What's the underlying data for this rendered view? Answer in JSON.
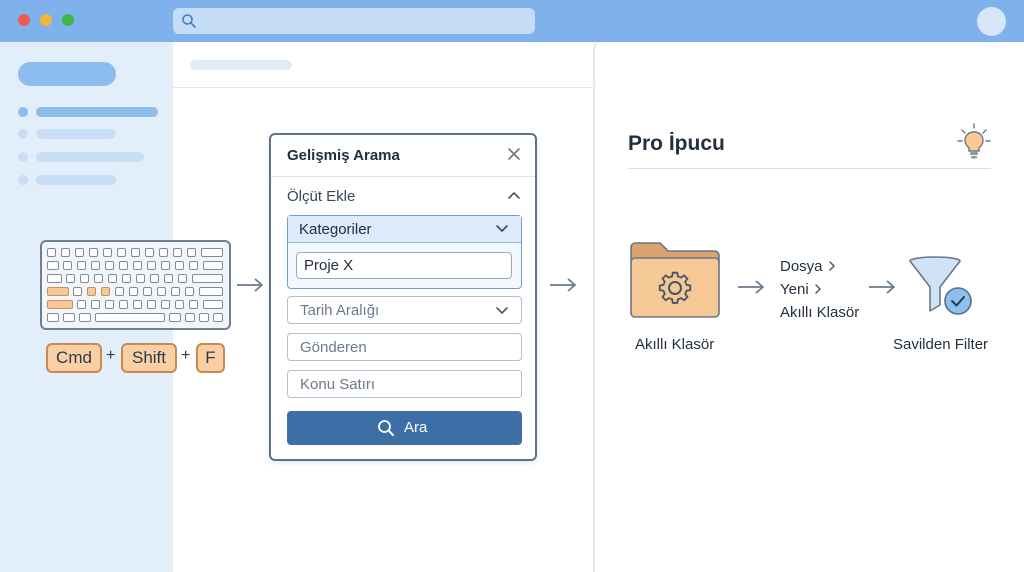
{
  "dialog": {
    "title": "Gelişmiş Arama",
    "criteria_label": "Ölçüt Ekle",
    "category_label": "Kategoriler",
    "category_value": "Proje X",
    "date_range_placeholder": "Tarih Aralığı",
    "sender_placeholder": "Gönderen",
    "subject_placeholder": "Konu Satırı",
    "search_button_label": "Ara"
  },
  "shortcut": {
    "keys": [
      "Cmd",
      "Shift",
      "F"
    ],
    "separator": "+"
  },
  "tip": {
    "title": "Pro İpucu",
    "folder_label": "Akıllı Klasör",
    "menu_path": [
      "Dosya",
      "Yeni",
      "Akıllı Klasör"
    ],
    "filter_label": "Savilden Filter"
  },
  "icons": {
    "search": "search-icon",
    "close": "close-icon",
    "chevron_up": "chevron-up-icon",
    "chevron_down": "chevron-down-icon",
    "chevron_right": "chevron-right-icon",
    "arrow_right": "arrow-right-icon",
    "lightbulb": "lightbulb-icon",
    "folder_gear": "folder-gear-icon",
    "funnel_check": "funnel-check-icon",
    "keyboard": "keyboard-icon"
  },
  "colors": {
    "titlebar": "#7fb2ea",
    "accent_button": "#3d6fa6",
    "key_highlight": "#f9d0a6",
    "folder": "#f6c896",
    "check_badge": "#8fc0ec"
  }
}
